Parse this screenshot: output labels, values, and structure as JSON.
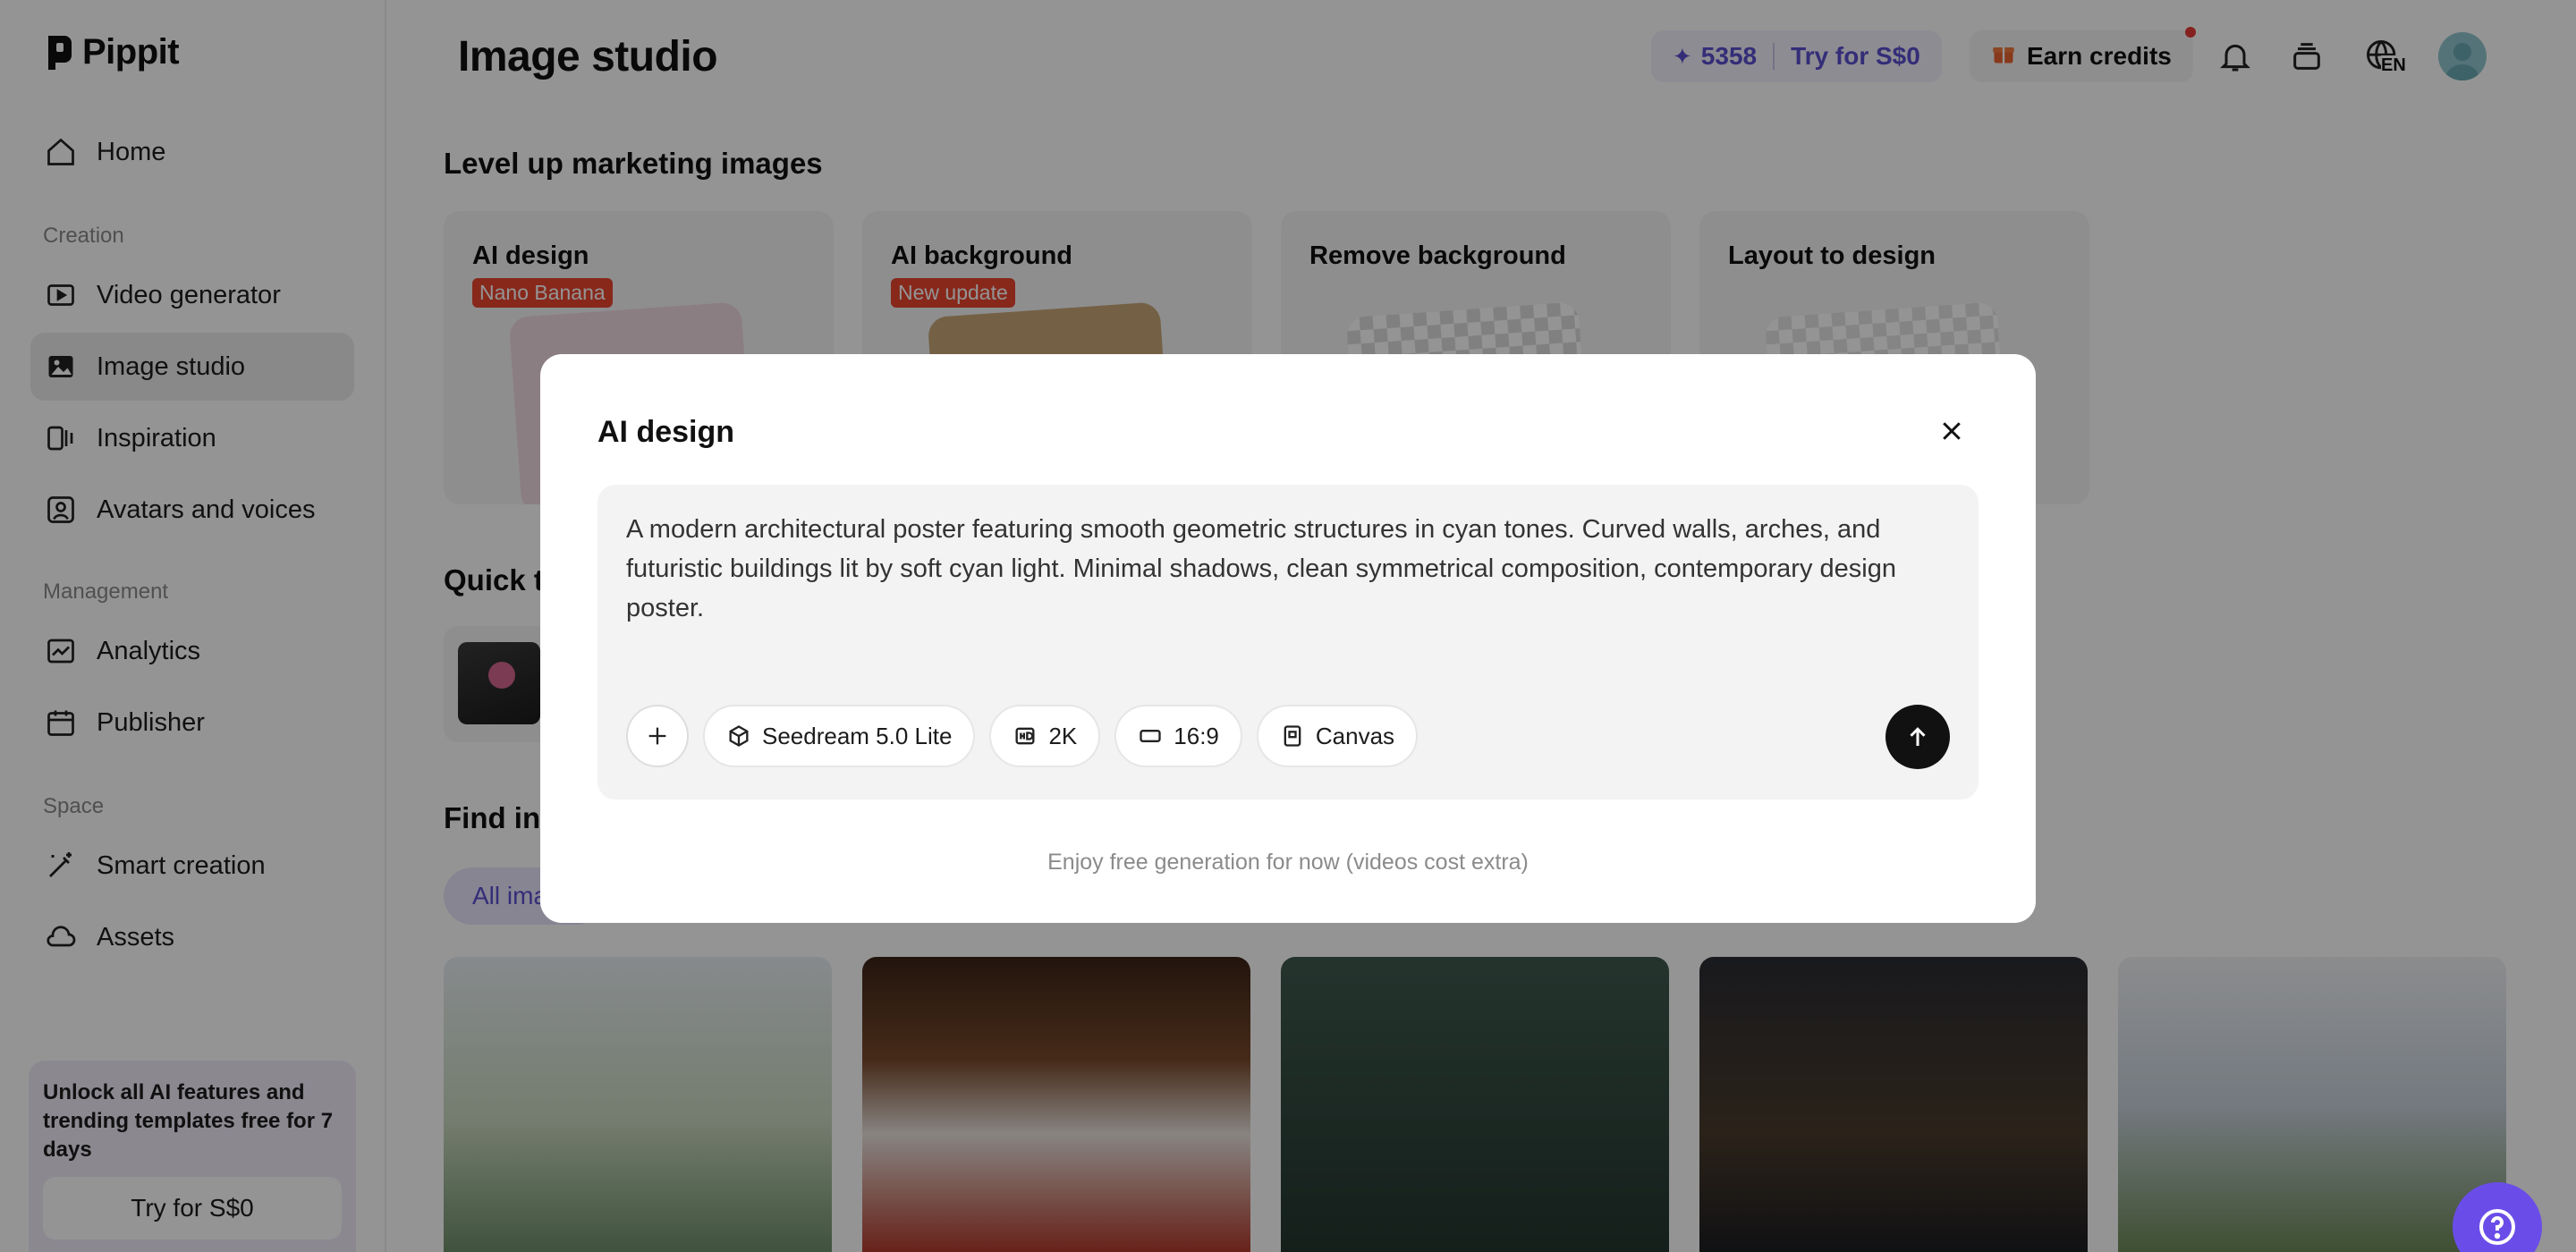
{
  "app": {
    "logo_text": "Pippit"
  },
  "sidebar": {
    "home": "Home",
    "creation_label": "Creation",
    "creation_items": [
      {
        "label": "Video generator",
        "icon": "video-icon"
      },
      {
        "label": "Image studio",
        "icon": "image-icon",
        "active": true
      },
      {
        "label": "Inspiration",
        "icon": "inspiration-icon"
      },
      {
        "label": "Avatars and voices",
        "icon": "avatar-icon"
      }
    ],
    "management_label": "Management",
    "management_items": [
      {
        "label": "Analytics",
        "icon": "analytics-icon"
      },
      {
        "label": "Publisher",
        "icon": "calendar-icon"
      }
    ],
    "space_label": "Space",
    "space_items": [
      {
        "label": "Smart creation",
        "icon": "magic-wand-icon"
      },
      {
        "label": "Assets",
        "icon": "cloud-icon"
      }
    ],
    "promo": {
      "text": "Unlock all AI features and trending templates free for 7 days",
      "button": "Try for S$0"
    }
  },
  "header": {
    "title": "Image studio",
    "credits": "5358",
    "try_label": "Try for S$0",
    "earn_label": "Earn credits",
    "language": "EN"
  },
  "main": {
    "section1_title": "Level up marketing images",
    "feature_cards": [
      {
        "title": "AI design",
        "badge": "Nano Banana"
      },
      {
        "title": "AI background",
        "badge": "New update"
      },
      {
        "title": "Remove background",
        "badge": ""
      },
      {
        "title": "Layout to design",
        "badge": ""
      }
    ],
    "section2_title": "Quick t",
    "section3_title": "Find ins",
    "filter_label": "All ima"
  },
  "modal": {
    "title": "AI design",
    "prompt": "A modern architectural poster featuring smooth geometric structures in cyan tones. Curved walls, arches, and futuristic buildings lit by soft cyan light. Minimal shadows, clean symmetrical composition, contemporary design poster.",
    "chips": {
      "model": "Seedream 5.0 Lite",
      "resolution": "2K",
      "ratio": "16:9",
      "mode": "Canvas"
    },
    "footnote": "Enjoy free generation for now (videos cost extra)"
  },
  "colors": {
    "accent": "#5a4fcf",
    "badge": "#e8462f",
    "help": "#6a4de8"
  }
}
